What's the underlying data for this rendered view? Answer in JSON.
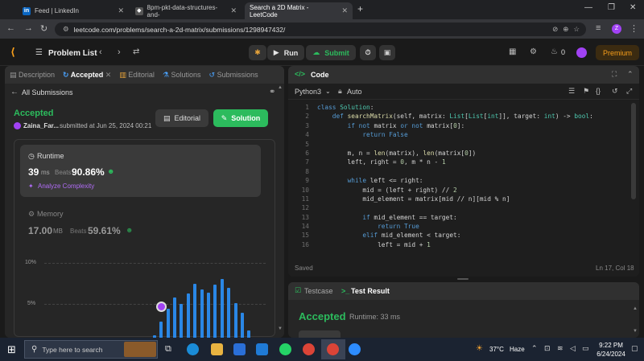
{
  "browser": {
    "tabs": [
      {
        "title": "Feed | LinkedIn",
        "icon": "linkedin-icon",
        "color": "#0a66c2",
        "glyph": "in"
      },
      {
        "title": "8pm-pkt-data-structures-and-",
        "icon": "github-icon",
        "color": "#555",
        "glyph": "◆"
      },
      {
        "title": "Search a 2D Matrix - LeetCode",
        "icon": "leetcode-icon",
        "color": "#f89f1b",
        "glyph": "L",
        "active": true
      }
    ],
    "new_tab": "+",
    "url": "leetcode.com/problems/search-a-2d-matrix/submissions/1298947432/",
    "profile_initial": "Z"
  },
  "lc_nav": {
    "problem_list": "Problem List",
    "run": "Run",
    "submit": "Submit",
    "fire_count": "0",
    "premium": "Premium"
  },
  "left": {
    "tabs": {
      "description": "Description",
      "accepted": "Accepted",
      "editorial": "Editorial",
      "solutions": "Solutions",
      "submissions": "Submissions"
    },
    "all_submissions": "All Submissions",
    "status": "Accepted",
    "user": "Zaina_Far...",
    "submitted_at": "submitted at Jun 25, 2024 00:21",
    "editorial_btn": "Editorial",
    "solution_btn": "Solution",
    "runtime": {
      "label": "Runtime",
      "value": "39",
      "unit": "ms",
      "beats_label": "Beats",
      "beats": "90.86%",
      "analyze": "Analyze Complexity"
    },
    "memory": {
      "label": "Memory",
      "value": "17.00",
      "unit": "MB",
      "beats_label": "Beats",
      "beats": "59.61%"
    },
    "hist": {
      "y10": "10%",
      "y5": "5%",
      "values": [
        0.5,
        0.6,
        1.2,
        2.8,
        4.4,
        5.8,
        5.0,
        6.3,
        7.5,
        6.8,
        6.4,
        7.4,
        8.0,
        7.0,
        5.1,
        3.9,
        1.8,
        0.9
      ]
    }
  },
  "editor": {
    "title": "Code",
    "language": "Python3",
    "mode": "Auto",
    "saved": "Saved",
    "cursor": "Ln 17, Col 18",
    "lines": [
      "class Solution:",
      "    def searchMatrix(self, matrix: List[List[int]], target: int) -> bool:",
      "        if not matrix or not matrix[0]:",
      "            return False",
      "",
      "        m, n = len(matrix), len(matrix[0])",
      "        left, right = 0, m * n - 1",
      "",
      "        while left <= right:",
      "            mid = (left + right) // 2",
      "            mid_element = matrix[mid // n][mid % n]",
      "",
      "            if mid_element == target:",
      "                return True",
      "            elif mid_element < target:",
      "                left = mid + 1"
    ]
  },
  "bottom": {
    "testcase": "Testcase",
    "test_result": "Test Result",
    "status": "Accepted",
    "runtime": "Runtime: 33 ms"
  },
  "taskbar": {
    "search": "Type here to search",
    "temp": "37°C",
    "weather": "Haze",
    "time": "9:22 PM",
    "date": "6/24/2024"
  }
}
